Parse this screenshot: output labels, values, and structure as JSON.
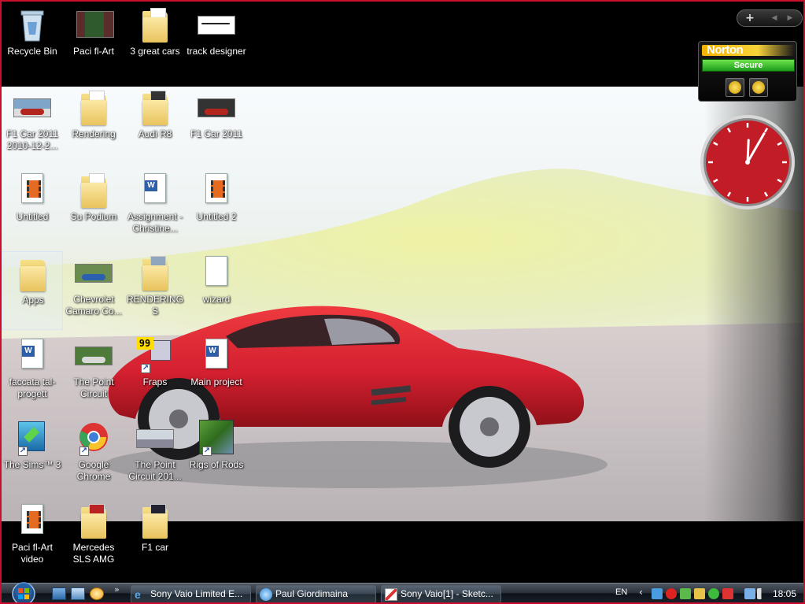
{
  "desktop": {
    "icons": [
      {
        "id": "recycle-bin",
        "label": "Recycle Bin"
      },
      {
        "id": "paci-fl-art",
        "label": "Paci fl-Art"
      },
      {
        "id": "3-great-cars",
        "label": "3 great cars"
      },
      {
        "id": "track-designer",
        "label": "track designer"
      },
      {
        "id": "f1-car-2011-2010",
        "label": "F1 Car 2011 2010-12-2..."
      },
      {
        "id": "rendering",
        "label": "Rendering"
      },
      {
        "id": "audi-r8",
        "label": "Audi R8"
      },
      {
        "id": "f1-car-2011",
        "label": "F1 Car 2011"
      },
      {
        "id": "untitled",
        "label": "Untitled"
      },
      {
        "id": "su-podium",
        "label": "Su Podium"
      },
      {
        "id": "assignment-christine",
        "label": "Assignment -Christine..."
      },
      {
        "id": "untitled-2",
        "label": "Untitled 2"
      },
      {
        "id": "apps",
        "label": "Apps"
      },
      {
        "id": "chevrolet-camaro",
        "label": "Chevrolet Camaro Co..."
      },
      {
        "id": "renderings",
        "label": "RENDERINGS"
      },
      {
        "id": "wizard",
        "label": "wizard"
      },
      {
        "id": "faccata-tal-progett",
        "label": "faccata tal-progett"
      },
      {
        "id": "the-point-circuit",
        "label": "The Point Circuit"
      },
      {
        "id": "fraps",
        "label": "Fraps"
      },
      {
        "id": "main-project",
        "label": "Main project"
      },
      {
        "id": "the-sims-3",
        "label": "The Sims™ 3"
      },
      {
        "id": "google-chrome",
        "label": "Google Chrome"
      },
      {
        "id": "the-point-circuit-201",
        "label": "The Point Circuit 201..."
      },
      {
        "id": "rigs-of-rods",
        "label": "Rigs of Rods"
      },
      {
        "id": "paci-fl-art-video",
        "label": "Paci fl-Art video"
      },
      {
        "id": "mercedes-sls-amg",
        "label": "Mercedes SLS AMG"
      },
      {
        "id": "f1-car",
        "label": "F1 car"
      }
    ],
    "fraps_counter": "99"
  },
  "gadgets": {
    "norton": {
      "title": "Norton",
      "status": "Secure"
    },
    "clock": {
      "hour": 12,
      "minute": 5
    }
  },
  "taskbar": {
    "buttons": [
      {
        "label": "Sony Vaio Limited E...",
        "icon": "ie-icon"
      },
      {
        "label": "Paul Giordimaina",
        "icon": "chat-icon"
      },
      {
        "label": "Sony Vaio[1] - Sketc...",
        "icon": "sketchup-icon"
      }
    ],
    "language": "EN",
    "time": "18:05"
  },
  "colors": {
    "frame": "#c8102e",
    "car": "#d42030",
    "norton_status": "#2db52d",
    "clock_face": "#c21c26"
  }
}
